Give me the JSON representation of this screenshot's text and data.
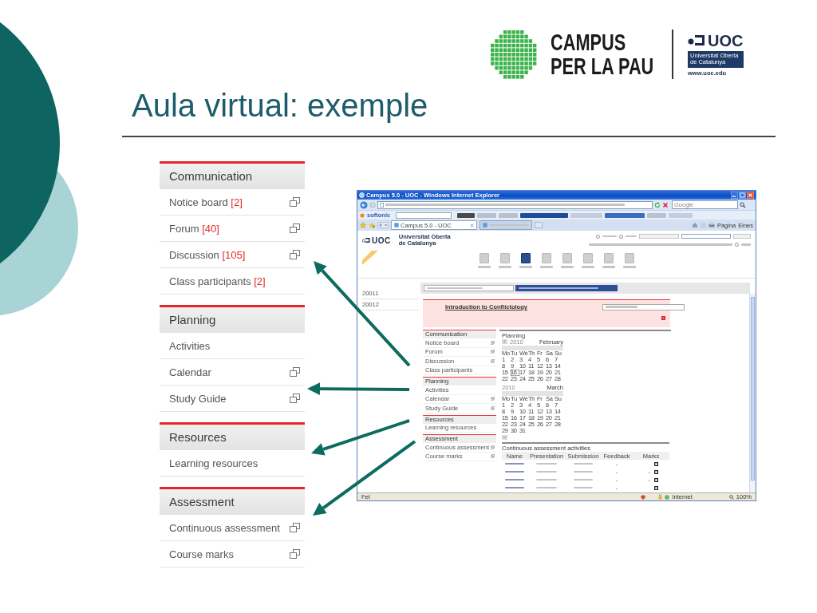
{
  "logo": {
    "name_lines": [
      "CAMPUS",
      "PER LA PAU"
    ],
    "partner": "UOC",
    "partner_full": [
      "Universitat Oberta",
      "de Catalunya"
    ],
    "partner_url": "www.uoc.edu"
  },
  "title": "Aula virtual: exemple",
  "menu": [
    {
      "heading": "Communication",
      "items": [
        {
          "label": "Notice board",
          "count": "[2]",
          "popup": true
        },
        {
          "label": "Forum",
          "count": "[40]",
          "popup": true
        },
        {
          "label": "Discussion",
          "count": "[105]",
          "popup": true
        },
        {
          "label": "Class participants",
          "count": "[2]",
          "popup": false
        }
      ]
    },
    {
      "heading": "Planning",
      "items": [
        {
          "label": "Activities",
          "popup": false
        },
        {
          "label": "Calendar",
          "popup": true
        },
        {
          "label": "Study Guide",
          "popup": true
        }
      ]
    },
    {
      "heading": "Resources",
      "items": [
        {
          "label": "Learning resources",
          "popup": false
        }
      ]
    },
    {
      "heading": "Assessment",
      "items": [
        {
          "label": "Continuous assessment",
          "popup": true
        },
        {
          "label": "Course marks",
          "popup": true
        }
      ]
    }
  ],
  "browser": {
    "title": "Campus 5.0 - UOC - Windows Internet Explorer",
    "search_placeholder": "Google",
    "toolbar_brand": "softonic",
    "tabs": [
      {
        "label": "Campus 5.0 - UOC",
        "selected": true
      },
      {
        "selected": false
      }
    ],
    "command_menus": [
      "Pàgina",
      "Eines"
    ],
    "site": {
      "logo": "UOC",
      "logo_name": [
        "Universitat Oberta",
        "de Catalunya"
      ],
      "nav": [
        {
          "selected": false
        },
        {
          "selected": false
        },
        {
          "selected": true
        },
        {
          "selected": false
        },
        {
          "selected": false
        },
        {
          "selected": false
        },
        {
          "selected": false
        },
        {
          "selected": false
        }
      ],
      "semesters": [
        "20011",
        "20012"
      ],
      "course_title": "Introduction to Conflictology",
      "menu": [
        {
          "heading": "Communication",
          "items": [
            {
              "label": "Notice board",
              "popup": true
            },
            {
              "label": "Forum",
              "popup": true
            },
            {
              "label": "Discussion",
              "popup": true
            },
            {
              "label": "Class participants",
              "popup": false
            }
          ]
        },
        {
          "heading": "Planning",
          "items": [
            {
              "label": "Activities",
              "popup": false
            },
            {
              "label": "Calendar",
              "popup": true
            },
            {
              "label": "Study Guide",
              "popup": true
            }
          ]
        },
        {
          "heading": "Resources",
          "items": [
            {
              "label": "Learning resources",
              "popup": false
            }
          ]
        },
        {
          "heading": "Assessment",
          "items": [
            {
              "label": "Continuous assessment",
              "popup": true
            },
            {
              "label": "Course marks",
              "popup": true
            }
          ]
        }
      ],
      "planning": {
        "title": "Planning",
        "months": [
          {
            "year": "2010",
            "name": "February",
            "weekdays": [
              "Mo",
              "Tu",
              "We",
              "Th",
              "Fr",
              "Sa",
              "Su"
            ],
            "weeks": [
              [
                {
                  "day": "1",
                  "selected": false
                },
                {
                  "day": "2",
                  "selected": false
                },
                {
                  "day": "3",
                  "selected": false
                },
                {
                  "day": "4",
                  "selected": false
                },
                {
                  "day": "5",
                  "selected": false
                },
                {
                  "day": "6",
                  "selected": false
                },
                {
                  "day": "7",
                  "selected": false
                }
              ],
              [
                {
                  "day": "8",
                  "selected": false
                },
                {
                  "day": "9",
                  "selected": false
                },
                {
                  "day": "10",
                  "selected": false
                },
                {
                  "day": "11",
                  "selected": false
                },
                {
                  "day": "12",
                  "selected": false
                },
                {
                  "day": "13",
                  "selected": false
                },
                {
                  "day": "14",
                  "selected": false
                }
              ],
              [
                {
                  "day": "15",
                  "selected": false
                },
                {
                  "day": "16",
                  "selected": true
                },
                {
                  "day": "17",
                  "selected": false
                },
                {
                  "day": "18",
                  "selected": false
                },
                {
                  "day": "19",
                  "selected": false
                },
                {
                  "day": "20",
                  "selected": false
                },
                {
                  "day": "21",
                  "selected": false
                }
              ],
              [
                {
                  "day": "22",
                  "selected": false
                },
                {
                  "day": "23",
                  "selected": false
                },
                {
                  "day": "24",
                  "selected": false
                },
                {
                  "day": "25",
                  "selected": false
                },
                {
                  "day": "26",
                  "selected": false
                },
                {
                  "day": "27",
                  "selected": false
                },
                {
                  "day": "28",
                  "selected": false
                }
              ]
            ]
          },
          {
            "year": "2010",
            "name": "March",
            "weekdays": [
              "Mo",
              "Tu",
              "We",
              "Th",
              "Fr",
              "Sa",
              "Su"
            ],
            "weeks": [
              [
                {
                  "day": "1",
                  "selected": false
                },
                {
                  "day": "2",
                  "selected": false
                },
                {
                  "day": "3",
                  "selected": false
                },
                {
                  "day": "4",
                  "selected": false
                },
                {
                  "day": "5",
                  "selected": false
                },
                {
                  "day": "6",
                  "selected": false
                },
                {
                  "day": "7",
                  "selected": false
                }
              ],
              [
                {
                  "day": "8",
                  "selected": false
                },
                {
                  "day": "9",
                  "selected": false
                },
                {
                  "day": "10",
                  "selected": false
                },
                {
                  "day": "11",
                  "selected": false
                },
                {
                  "day": "12",
                  "selected": false
                },
                {
                  "day": "13",
                  "selected": false
                },
                {
                  "day": "14",
                  "selected": false
                }
              ],
              [
                {
                  "day": "15",
                  "selected": false
                },
                {
                  "day": "16",
                  "selected": false
                },
                {
                  "day": "17",
                  "selected": false
                },
                {
                  "day": "18",
                  "selected": false
                },
                {
                  "day": "19",
                  "selected": false
                },
                {
                  "day": "20",
                  "selected": false
                },
                {
                  "day": "21",
                  "selected": false
                }
              ],
              [
                {
                  "day": "22",
                  "selected": false
                },
                {
                  "day": "23",
                  "selected": false
                },
                {
                  "day": "24",
                  "selected": false
                },
                {
                  "day": "25",
                  "selected": false
                },
                {
                  "day": "26",
                  "selected": false
                },
                {
                  "day": "27",
                  "selected": false
                },
                {
                  "day": "28",
                  "selected": false
                }
              ],
              [
                {
                  "day": "29",
                  "selected": false
                },
                {
                  "day": "30",
                  "selected": false
                },
                {
                  "day": "31",
                  "selected": false
                }
              ]
            ]
          }
        ]
      },
      "assessment": {
        "title": "Continuous assessment activities",
        "columns": [
          "Name",
          "Presentation",
          "Submission",
          "Feedback",
          "Marks"
        ],
        "rows": [
          {
            "feedback": "-"
          },
          {
            "feedback": "-",
            "mark": "-"
          },
          {
            "feedback": "-",
            "mark": "-"
          },
          {
            "feedback": "-"
          }
        ]
      }
    },
    "status": {
      "text": "Fet",
      "zone": "Internet",
      "zoom": "100%"
    }
  }
}
